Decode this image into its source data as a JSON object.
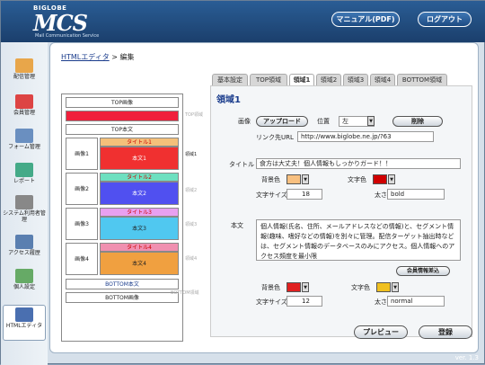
{
  "header": {
    "logo_small": "BIGLOBE",
    "logo_big": "MCS",
    "logo_sub": "Mail Communication Service",
    "manual_label": "マニュアル(PDF)",
    "logout_label": "ログアウト"
  },
  "sidebar": {
    "items": [
      {
        "label": "配信管理",
        "icon": "envelope-icon",
        "color": "#e8a64a"
      },
      {
        "label": "会員管理",
        "icon": "members-icon",
        "color": "#d44"
      },
      {
        "label": "フォーム管理",
        "icon": "form-icon",
        "color": "#6a8fc0"
      },
      {
        "label": "レポート",
        "icon": "report-icon",
        "color": "#4a8"
      },
      {
        "label": "システム利用者管理",
        "icon": "system-user-icon",
        "color": "#888"
      },
      {
        "label": "アクセス履歴",
        "icon": "access-icon",
        "color": "#5a7fb0"
      },
      {
        "label": "個人設定",
        "icon": "personal-icon",
        "color": "#6a6"
      },
      {
        "label": "HTMLエディタ",
        "icon": "html-editor-icon",
        "color": "#4a6fb0"
      }
    ]
  },
  "breadcrumb": {
    "link": "HTMLエディタ",
    "sep": ">",
    "current": "編集"
  },
  "layout": {
    "top_image": "TOP画像",
    "top_body": "TOP本文",
    "bottom_body": "BOTTOM本文",
    "bottom_image": "BOTTOM画像",
    "top_tag": "TOP領域",
    "bottom_tag": "BOTTOM領域",
    "selected_tag": "領域1",
    "rows": [
      {
        "img": "画像1",
        "title": "タイトル1",
        "body": "本文1",
        "title_color": "#f4c07a",
        "body_color": "#f03030"
      },
      {
        "img": "画像2",
        "title": "タイトル2",
        "body": "本文2",
        "title_color": "#6ee0c0",
        "body_color": "#5050f0"
      },
      {
        "img": "画像3",
        "title": "タイトル3",
        "body": "本文3",
        "title_color": "#e8a0f0",
        "body_color": "#50c8f0"
      },
      {
        "img": "画像4",
        "title": "タイトル4",
        "body": "本文4",
        "title_color": "#f090b0",
        "body_color": "#f0a040"
      }
    ],
    "side_tags": [
      "領域1",
      "領域2",
      "領域3",
      "領域4"
    ]
  },
  "tabs": [
    "基本設定",
    "TOP領域",
    "領域1",
    "領域2",
    "領域3",
    "領域4",
    "BOTTOM領域"
  ],
  "editor": {
    "heading": "領域1",
    "image_label": "画像",
    "upload_label": "アップロード",
    "position_label": "位置",
    "position_value": "左",
    "delete_label": "削除",
    "link_label": "リンク先URL",
    "link_value": "http://www.biglobe.ne.jp/?63",
    "title_label": "タイトル",
    "title_value": "食方は大丈夫！個人情報もしっかりガード！！",
    "bg_label": "背景色",
    "fg_label": "文字色",
    "size_label": "文字サイズ",
    "size_value": "18",
    "weight_label": "太さ",
    "weight_value": "bold",
    "bg_color": "#f8c080",
    "fg_color": "#d00000",
    "body_label": "本文",
    "body_value": "個人情報(氏名、住所、メールアドレスなどの情報)と、セグメント情報(趣味、嗜好などの情報)を別々に管理。配信ターゲット抽出時などは、セグメント情報のデータベースのみにアクセス。個人情報へのアクセス頻度を最小限",
    "member_insert_label": "会員情報差込",
    "bg2_color": "#e02020",
    "fg2_color": "#f0c020",
    "size2_value": "12",
    "weight2_value": "normal"
  },
  "buttons": {
    "preview": "プレビュー",
    "register": "登録"
  },
  "footer": {
    "version": "ver. 1.3"
  }
}
